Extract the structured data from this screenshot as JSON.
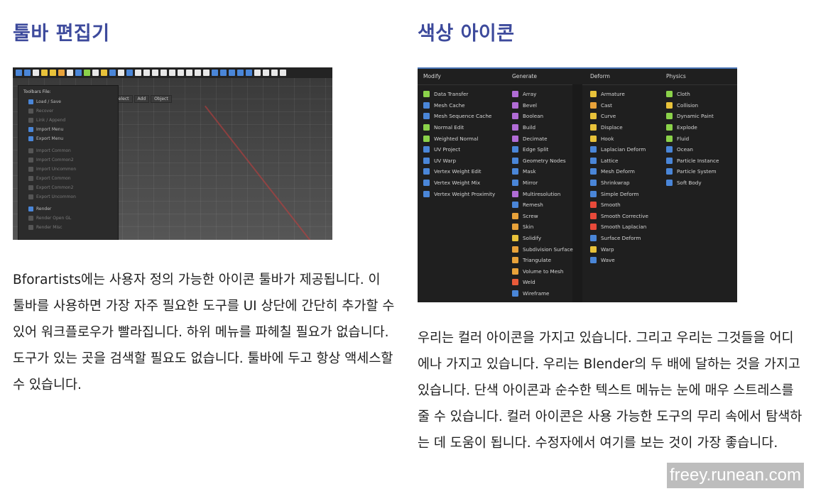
{
  "left": {
    "title": "툴바 편집기",
    "paragraph": "Bforartists에는 사용자 정의 가능한 아이콘 툴바가 제공됩니다. 이 툴바를 사용하면 가장 자주 필요한 도구를 UI 상단에 간단히 추가할 수 있어 워크플로우가 빨라집니다. 하위 메뉴를 파헤칠 필요가 없습니다. 도구가 있는 곳을 검색할 필요도 없습니다. 툴바에 두고 항상 액세스할 수 있습니다.",
    "screenshot": {
      "panel_title": "Toolbars File:",
      "menu": [
        "Select",
        "Add",
        "Object"
      ],
      "rows": [
        {
          "label": "Load / Save",
          "checked": true
        },
        {
          "label": "Recover",
          "checked": false
        },
        {
          "label": "Link / Append",
          "checked": false
        },
        {
          "label": "Import Menu",
          "checked": true
        },
        {
          "label": "Export Menu",
          "checked": true
        },
        {
          "label": "Import Common",
          "checked": false
        },
        {
          "label": "Import Common2",
          "checked": false
        },
        {
          "label": "Import Uncommon",
          "checked": false
        },
        {
          "label": "Export Common",
          "checked": false
        },
        {
          "label": "Export Common2",
          "checked": false
        },
        {
          "label": "Export Uncommon",
          "checked": false
        },
        {
          "label": "Render",
          "checked": true
        },
        {
          "label": "Render Open GL",
          "checked": false
        },
        {
          "label": "Render Misc",
          "checked": false
        }
      ]
    }
  },
  "right": {
    "title": "색상 아이콘",
    "paragraph": "우리는 컬러 아이콘을 가지고 있습니다. 그리고 우리는 그것들을 어디에나 가지고 있습니다. 우리는 Blender의 두 배에 달하는 것을 가지고 있습니다. 단색 아이콘과 순수한 텍스트 메뉴는 눈에 매우 스트레스를 줄 수 있습니다. 컬러 아이콘은 사용 가능한 도구의 무리 속에서 탐색하는 데 도움이 됩니다. 수정자에서 여기를 보는 것이 가장 좋습니다.",
    "screenshot": {
      "columns": [
        {
          "header": "Modify",
          "items": [
            {
              "label": "Data Transfer",
              "color": "#8bd24a"
            },
            {
              "label": "Mesh Cache",
              "color": "#4a86d8"
            },
            {
              "label": "Mesh Sequence Cache",
              "color": "#4a86d8"
            },
            {
              "label": "Normal Edit",
              "color": "#8bd24a"
            },
            {
              "label": "Weighted Normal",
              "color": "#8bd24a"
            },
            {
              "label": "UV Project",
              "color": "#4a86d8"
            },
            {
              "label": "UV Warp",
              "color": "#4a86d8"
            },
            {
              "label": "Vertex Weight Edit",
              "color": "#4a86d8"
            },
            {
              "label": "Vertex Weight Mix",
              "color": "#4a86d8"
            },
            {
              "label": "Vertex Weight Proximity",
              "color": "#4a86d8"
            }
          ]
        },
        {
          "header": "Generate",
          "items": [
            {
              "label": "Array",
              "color": "#b16cd6"
            },
            {
              "label": "Bevel",
              "color": "#b16cd6"
            },
            {
              "label": "Boolean",
              "color": "#b16cd6"
            },
            {
              "label": "Build",
              "color": "#b16cd6"
            },
            {
              "label": "Decimate",
              "color": "#b16cd6"
            },
            {
              "label": "Edge Split",
              "color": "#4a86d8"
            },
            {
              "label": "Geometry Nodes",
              "color": "#4a86d8"
            },
            {
              "label": "Mask",
              "color": "#4a86d8"
            },
            {
              "label": "Mirror",
              "color": "#4a86d8"
            },
            {
              "label": "Multiresolution",
              "color": "#b16cd6"
            },
            {
              "label": "Remesh",
              "color": "#4a86d8"
            },
            {
              "label": "Screw",
              "color": "#e8a23a"
            },
            {
              "label": "Skin",
              "color": "#e8a23a"
            },
            {
              "label": "Solidify",
              "color": "#e8c23a"
            },
            {
              "label": "Subdivision Surface",
              "color": "#e8a23a"
            },
            {
              "label": "Triangulate",
              "color": "#e8a23a"
            },
            {
              "label": "Volume to Mesh",
              "color": "#e8a23a"
            },
            {
              "label": "Weld",
              "color": "#e85a3a"
            },
            {
              "label": "Wireframe",
              "color": "#4a86d8"
            }
          ]
        },
        {
          "header": "Deform",
          "items": [
            {
              "label": "Armature",
              "color": "#e8c23a"
            },
            {
              "label": "Cast",
              "color": "#e8a23a"
            },
            {
              "label": "Curve",
              "color": "#e8c23a"
            },
            {
              "label": "Displace",
              "color": "#e8c23a"
            },
            {
              "label": "Hook",
              "color": "#e8c23a"
            },
            {
              "label": "Laplacian Deform",
              "color": "#4a86d8"
            },
            {
              "label": "Lattice",
              "color": "#4a86d8"
            },
            {
              "label": "Mesh Deform",
              "color": "#4a86d8"
            },
            {
              "label": "Shrinkwrap",
              "color": "#4a86d8"
            },
            {
              "label": "Simple Deform",
              "color": "#4a86d8"
            },
            {
              "label": "Smooth",
              "color": "#e84a3a"
            },
            {
              "label": "Smooth Corrective",
              "color": "#e84a3a"
            },
            {
              "label": "Smooth Laplacian",
              "color": "#e84a3a"
            },
            {
              "label": "Surface Deform",
              "color": "#4a86d8"
            },
            {
              "label": "Warp",
              "color": "#e8c23a"
            },
            {
              "label": "Wave",
              "color": "#4a86d8"
            }
          ]
        },
        {
          "header": "Physics",
          "items": [
            {
              "label": "Cloth",
              "color": "#8bd24a"
            },
            {
              "label": "Collision",
              "color": "#e8c23a"
            },
            {
              "label": "Dynamic Paint",
              "color": "#8bd24a"
            },
            {
              "label": "Explode",
              "color": "#8bd24a"
            },
            {
              "label": "Fluid",
              "color": "#8bd24a"
            },
            {
              "label": "Ocean",
              "color": "#4a86d8"
            },
            {
              "label": "Particle Instance",
              "color": "#4a86d8"
            },
            {
              "label": "Particle System",
              "color": "#4a86d8"
            },
            {
              "label": "Soft Body",
              "color": "#4a86d8"
            }
          ]
        }
      ]
    }
  },
  "watermark": "freey.runean.com",
  "colors": {
    "title": "#3d4a9c",
    "accent": "#4772b3"
  }
}
